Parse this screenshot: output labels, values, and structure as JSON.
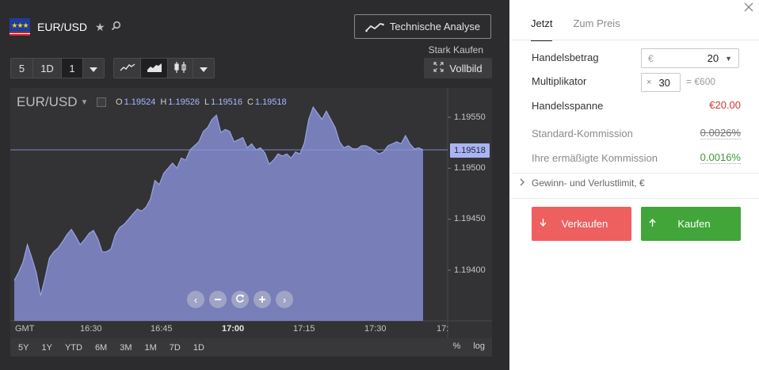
{
  "header": {
    "symbol": "EUR/USD",
    "star_icon": "star-icon",
    "search_icon": "search-icon",
    "technical_analysis_label": "Technische Analyse",
    "rating": "Stark Kaufen",
    "fullscreen_label": "Vollbild"
  },
  "toolbar": {
    "interval_buttons": [
      "5",
      "1D",
      "1"
    ],
    "active_interval": "1",
    "chart_type_icons": [
      "line-chart-icon",
      "area-chart-icon",
      "candlestick-icon"
    ],
    "active_chart_type": "area-chart-icon"
  },
  "chart": {
    "pair": "EUR/USD",
    "ohlc": {
      "O": "1.19524",
      "H": "1.19526",
      "L": "1.19516",
      "C": "1.19518"
    },
    "current_price": "1.19518",
    "timezone": "GMT",
    "range_buttons": [
      "5Y",
      "1Y",
      "YTD",
      "6M",
      "3M",
      "1M",
      "7D",
      "1D"
    ],
    "scale_buttons": [
      "%",
      "log"
    ],
    "nav_icons": [
      "arrow-left-icon",
      "zoom-out-icon",
      "reset-icon",
      "zoom-in-icon",
      "arrow-right-icon"
    ],
    "colors": {
      "area_fill": "#7e86c6",
      "area_line": "#9aa2e0",
      "price_badge": "#a9b4f0"
    }
  },
  "chart_data": {
    "type": "area",
    "title": "EUR/USD",
    "xlabel": "",
    "ylabel": "",
    "x_ticks": [
      "16:30",
      "16:45",
      "17:00",
      "17:15",
      "17:30",
      "17:"
    ],
    "bold_x_tick": "17:00",
    "y_ticks": [
      "1.19550",
      "1.19500",
      "1.19450",
      "1.19400"
    ],
    "ylim": [
      1.1935,
      1.1957
    ],
    "series": [
      {
        "values": [
          1.1939,
          1.19398,
          1.19408,
          1.19425,
          1.19412,
          1.19398,
          1.19375,
          1.19392,
          1.19412,
          1.19418,
          1.19422,
          1.19428,
          1.19435,
          1.1944,
          1.19433,
          1.19425,
          1.1943,
          1.19436,
          1.19439,
          1.19431,
          1.19418,
          1.19418,
          1.19421,
          1.19435,
          1.19442,
          1.19445,
          1.1945,
          1.19455,
          1.1946,
          1.19458,
          1.19462,
          1.1947,
          1.19488,
          1.19484,
          1.19495,
          1.195,
          1.19505,
          1.195,
          1.1951,
          1.19508,
          1.19518,
          1.19522,
          1.19526,
          1.19536,
          1.1954,
          1.19548,
          1.19552,
          1.19535,
          1.19538,
          1.19536,
          1.19526,
          1.19528,
          1.1953,
          1.1952,
          1.19524,
          1.19518,
          1.1952,
          1.19515,
          1.19504,
          1.19508,
          1.19514,
          1.19512,
          1.19514,
          1.1951,
          1.19516,
          1.19514,
          1.19525,
          1.19548,
          1.1956,
          1.19554,
          1.19548,
          1.19556,
          1.19548,
          1.1954,
          1.19526,
          1.1952,
          1.19522,
          1.19519,
          1.19519,
          1.19522,
          1.19522,
          1.1952,
          1.19517,
          1.19514,
          1.19516,
          1.19522,
          1.19524,
          1.19526,
          1.19524,
          1.19532,
          1.19524,
          1.19519,
          1.1952,
          1.19518
        ]
      }
    ]
  },
  "panel": {
    "tabs": [
      "Jetzt",
      "Zum Preis"
    ],
    "active_tab": "Jetzt",
    "amount_label": "Handelsbetrag",
    "amount_currency": "€",
    "amount_value": "20",
    "multiplier_label": "Multiplikator",
    "multiplier_prefix": "×",
    "multiplier_value": "30",
    "multiplier_result": "= €600",
    "spread_label": "Handelsspanne",
    "spread_value": "€20.00",
    "standard_commission_label": "Standard-Kommission",
    "standard_commission_value": "0.0026%",
    "reduced_commission_label": "Ihre ermäßigte Kommission",
    "reduced_commission_value": "0.0016%",
    "limit_label": "Gewinn- und Verlustlimit, €",
    "sell_label": "Verkaufen",
    "buy_label": "Kaufen",
    "colors": {
      "sell": "#ee5f5f",
      "buy": "#41a53a",
      "spread": "#d0352e",
      "discount": "#3c9a34"
    }
  }
}
